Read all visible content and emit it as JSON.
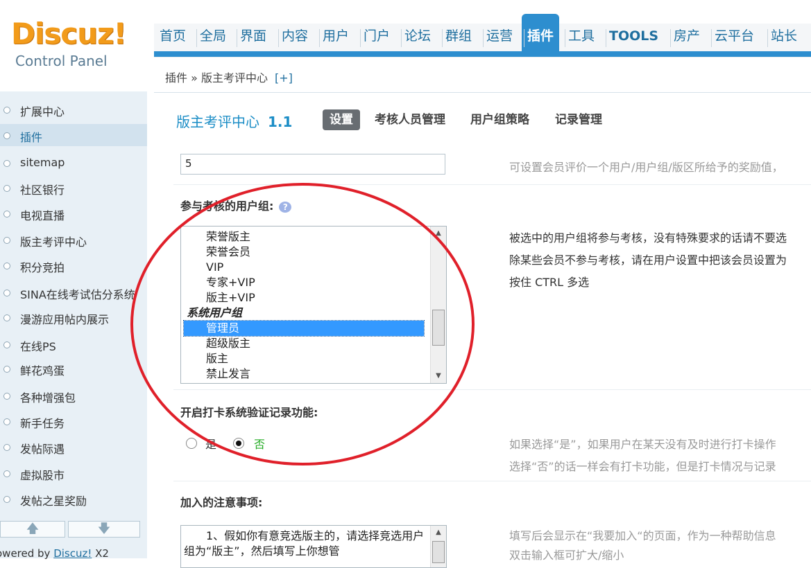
{
  "logo": {
    "brand": "Discuz!",
    "subtitle": "Control Panel"
  },
  "nav": {
    "items": [
      "首页",
      "全局",
      "界面",
      "内容",
      "用户",
      "门户",
      "论坛",
      "群组",
      "运营",
      "插件",
      "工具",
      "TOOLS",
      "房产",
      "云平台",
      "站长"
    ],
    "active": "插件"
  },
  "breadcrumb": {
    "path": "插件 » 版主考评中心",
    "expand": "[+]"
  },
  "sidebar": {
    "items": [
      "扩展中心",
      "插件",
      "sitemap",
      "社区银行",
      "电视直播",
      "版主考评中心",
      "积分竞拍",
      "SINA在线考试估分系统",
      "漫游应用帖内展示",
      "在线PS",
      "鲜花鸡蛋",
      "各种增强包",
      "新手任务",
      "发帖际遇",
      "虚拟股市",
      "发帖之星奖励"
    ],
    "active": "插件",
    "up_arrow": "🡅",
    "down_arrow": "🡇",
    "powered_prefix": "owered by ",
    "powered_link": "Discuz!",
    "powered_suffix": " X2"
  },
  "plugin": {
    "title": "版主考评中心",
    "version": "1.1",
    "tabs": [
      "设置",
      "考核人员管理",
      "用户组策略",
      "记录管理"
    ],
    "active_tab": "设置"
  },
  "form": {
    "reward_value": "5",
    "reward_hint": "可设置会员评价一个用户/用户组/版区所给予的奖励值，",
    "groups_label": "参与考核的用户组:",
    "groups_help_icon": "question-bubble",
    "group_options": [
      {
        "text": "荣誉版主",
        "group": false,
        "selected": false
      },
      {
        "text": "荣誉会员",
        "group": false,
        "selected": false
      },
      {
        "text": "VIP",
        "group": false,
        "selected": false
      },
      {
        "text": "专家+VIP",
        "group": false,
        "selected": false
      },
      {
        "text": "版主+VIP",
        "group": false,
        "selected": false
      },
      {
        "text": "系统用户组",
        "group": true,
        "selected": false
      },
      {
        "text": "管理员",
        "group": false,
        "selected": true
      },
      {
        "text": "超级版主",
        "group": false,
        "selected": false
      },
      {
        "text": "版主",
        "group": false,
        "selected": false
      },
      {
        "text": "禁止发言",
        "group": false,
        "selected": false
      }
    ],
    "groups_hint_lines": [
      "被选中的用户组将参与考核，没有特殊要求的话请不要选",
      "除某些会员不参与考核，请在用户设置中把该会员设置为",
      "按住 CTRL 多选"
    ],
    "checkin_label": "开启打卡系统验证记录功能:",
    "checkin_yes": "是",
    "checkin_no": "否",
    "checkin_value": "否",
    "checkin_hint_lines": [
      "如果选择“是”，如果用户在某天没有及时进行打卡操作",
      "选择“否”的话一样会有打卡功能，但是打卡情况与记录"
    ],
    "notes_label": "加入的注意事项:",
    "notes_text": "　　1、假如你有意竞选版主的，请选择竞选用户组为“版主”，然后填写上你想管",
    "notes_hint_lines": [
      "填写后会显示在“我要加入“的页面，作为一种帮助信息",
      "双击输入框可扩大/缩小"
    ]
  },
  "colors": {
    "accent": "#2d8ecf",
    "annotation": "#e0202a",
    "selection": "#3399ff",
    "logo": "#f29b1a"
  }
}
